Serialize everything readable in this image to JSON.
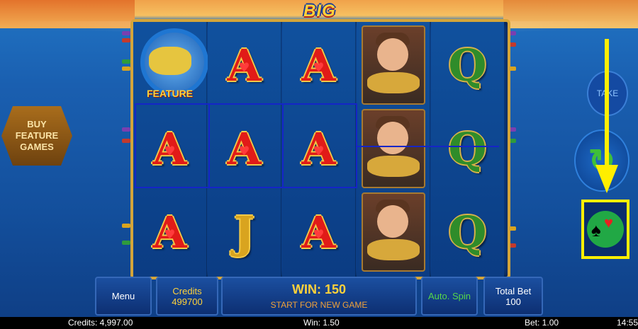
{
  "game": {
    "title": "BIG FISH"
  },
  "reels": [
    [
      {
        "type": "feature",
        "label": "FEATURE"
      },
      {
        "type": "A"
      },
      {
        "type": "A"
      }
    ],
    [
      {
        "type": "A"
      },
      {
        "type": "A"
      },
      {
        "type": "J"
      }
    ],
    [
      {
        "type": "A"
      },
      {
        "type": "A"
      },
      {
        "type": "A"
      }
    ],
    [
      {
        "type": "fisherman"
      },
      {
        "type": "fisherman"
      },
      {
        "type": "fisherman"
      }
    ],
    [
      {
        "type": "Q"
      },
      {
        "type": "Q"
      },
      {
        "type": "Q"
      }
    ]
  ],
  "buttons": {
    "buy_feature": [
      "BUY",
      "FEATURE",
      "GAMES"
    ],
    "take": "TAKE",
    "spin_icon": "spin-arrows-icon",
    "gamble_icon": "card-suits-icon"
  },
  "bottom_panel": {
    "menu": "Menu",
    "credits_label": "Credits",
    "credits_value": "499700",
    "win_label": "WIN: 150",
    "win_message": "START FOR NEW GAME",
    "autospin": "Auto. Spin",
    "total_bet_label": "Total Bet",
    "total_bet_value": "100"
  },
  "status_bar": {
    "credits": "Credits: 4,997.00",
    "win": "Win: 1.50",
    "bet": "Bet: 1.00",
    "time": "14:55"
  },
  "colors": {
    "highlight": "#ffee00",
    "winline": "#1525c7",
    "frame": "#d4a53a"
  }
}
